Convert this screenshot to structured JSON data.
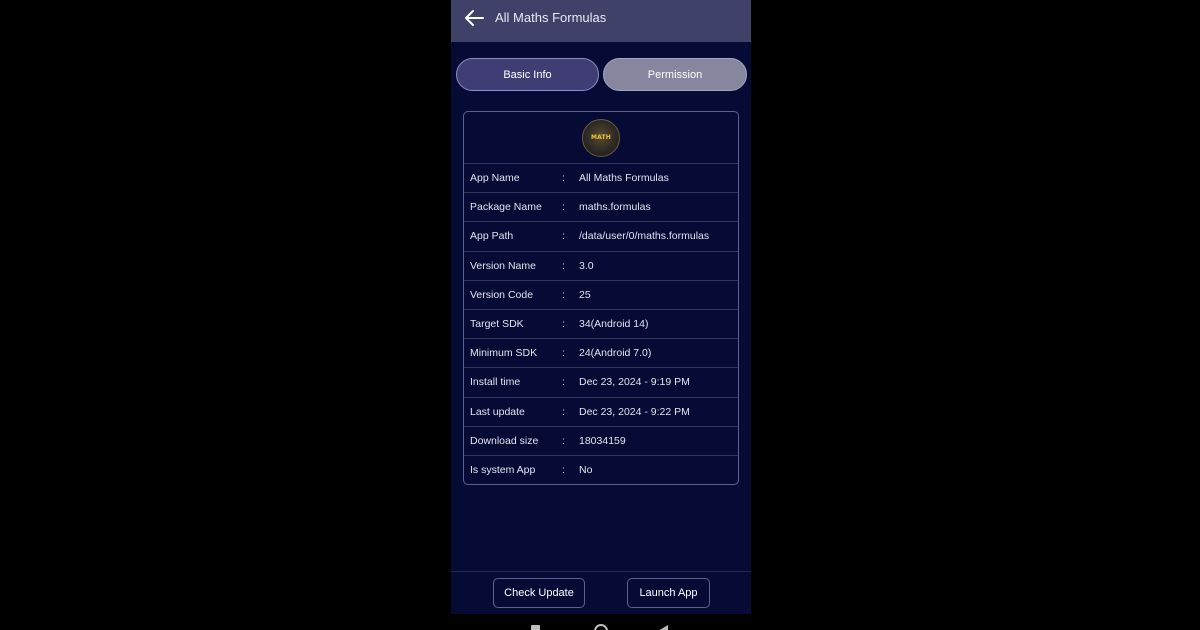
{
  "appbar": {
    "title": "All Maths Formulas",
    "back_icon": "arrow-left-icon"
  },
  "tabs": [
    {
      "label": "Basic Info",
      "active": true
    },
    {
      "label": "Permission",
      "active": false
    }
  ],
  "app_icon": {
    "icon": "math-formulas-app-icon",
    "text": "MATH"
  },
  "info": [
    {
      "label": "App Name",
      "sep": ":",
      "value": "All Maths Formulas"
    },
    {
      "label": "Package Name",
      "sep": ":",
      "value": "maths.formulas"
    },
    {
      "label": "App Path",
      "sep": ":",
      "value": "/data/user/0/maths.formulas"
    },
    {
      "label": "Version Name",
      "sep": ":",
      "value": "3.0"
    },
    {
      "label": "Version Code",
      "sep": ":",
      "value": "25"
    },
    {
      "label": "Target SDK",
      "sep": ":",
      "value": "34(Android 14)"
    },
    {
      "label": "Minimum SDK",
      "sep": ":",
      "value": "24(Android 7.0)"
    },
    {
      "label": "Install time",
      "sep": ":",
      "value": "Dec 23, 2024 - 9:19 PM"
    },
    {
      "label": "Last update",
      "sep": ":",
      "value": "Dec 23, 2024 - 9:22 PM"
    },
    {
      "label": "Download size",
      "sep": ":",
      "value": "18034159"
    },
    {
      "label": "Is system App",
      "sep": ":",
      "value": "No"
    }
  ],
  "buttons": {
    "check_update": "Check Update",
    "launch_app": "Launch App"
  },
  "colors": {
    "background": "#060b35",
    "appbar": "#3f4168",
    "tab_active": "#3f3d74",
    "tab_inactive": "#86869e"
  }
}
